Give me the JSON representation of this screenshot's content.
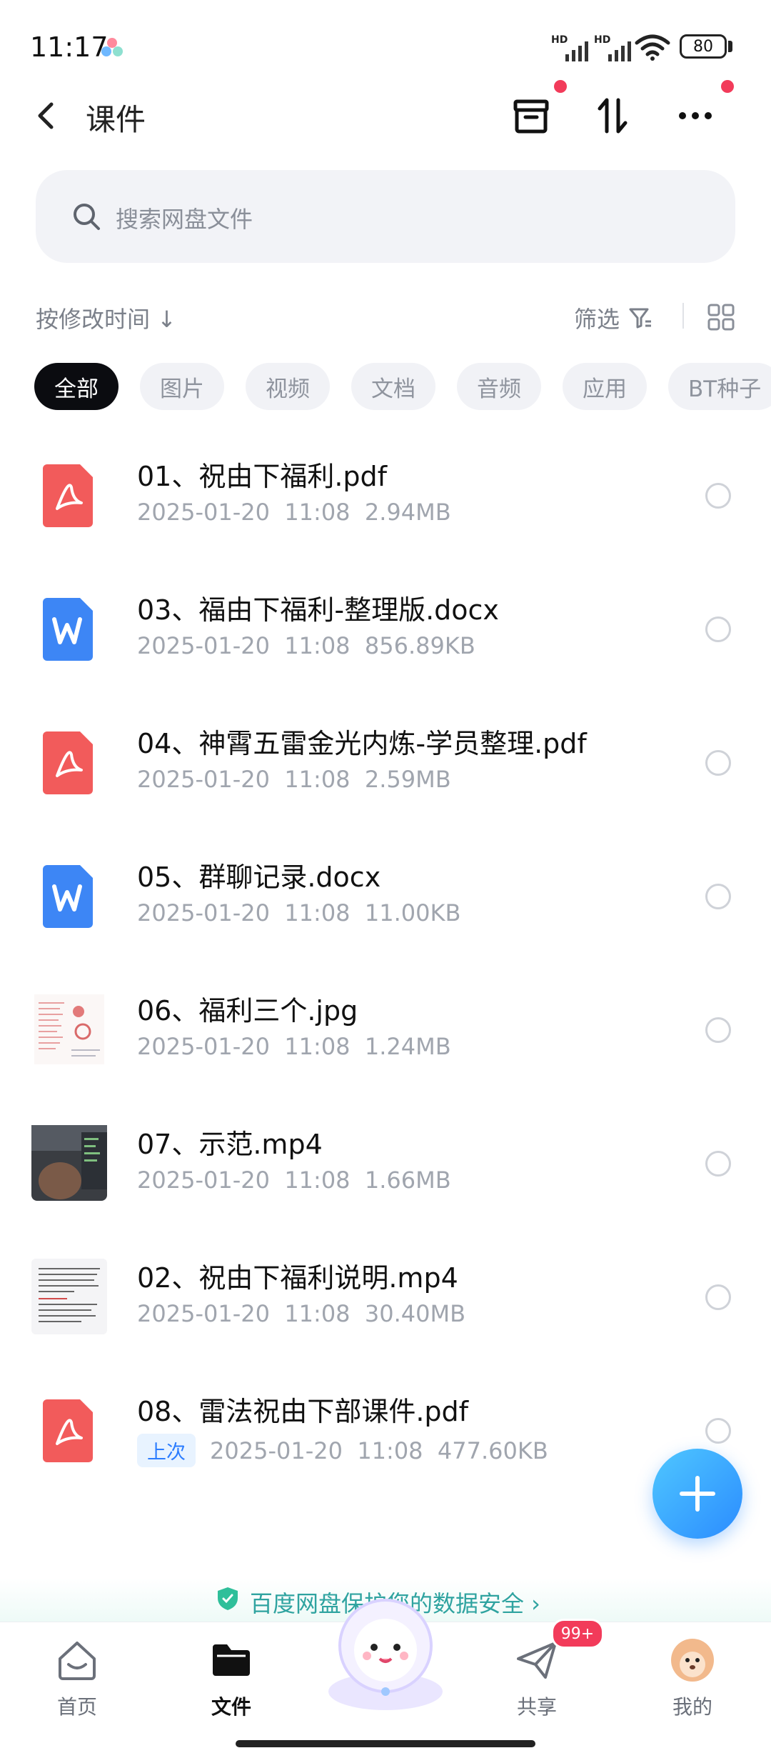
{
  "status_bar": {
    "time": "11:17",
    "sim1": "HD",
    "sim2": "HD",
    "battery": "80"
  },
  "header": {
    "title": "课件"
  },
  "search": {
    "placeholder": "搜索网盘文件"
  },
  "toolbar": {
    "sort_label": "按修改时间 ↓",
    "filter_label": "筛选"
  },
  "chips": [
    "全部",
    "图片",
    "视频",
    "文档",
    "音频",
    "应用",
    "BT种子"
  ],
  "files": [
    {
      "name": "01、祝由下福利.pdf",
      "date": "2025-01-20",
      "time": "11:08",
      "size": "2.94MB",
      "type": "pdf"
    },
    {
      "name": "03、福由下福利-整理版.docx",
      "date": "2025-01-20",
      "time": "11:08",
      "size": "856.89KB",
      "type": "word"
    },
    {
      "name": "04、神霄五雷金光内炼-学员整理.pdf",
      "date": "2025-01-20",
      "time": "11:08",
      "size": "2.59MB",
      "type": "pdf"
    },
    {
      "name": "05、群聊记录.docx",
      "date": "2025-01-20",
      "time": "11:08",
      "size": "11.00KB",
      "type": "word"
    },
    {
      "name": "06、福利三个.jpg",
      "date": "2025-01-20",
      "time": "11:08",
      "size": "1.24MB",
      "type": "image"
    },
    {
      "name": "07、示范.mp4",
      "date": "2025-01-20",
      "time": "11:08",
      "size": "1.66MB",
      "type": "video"
    },
    {
      "name": "02、祝由下福利说明.mp4",
      "date": "2025-01-20",
      "time": "11:08",
      "size": "30.40MB",
      "type": "doc-thumb"
    },
    {
      "name": "08、雷法祝由下部课件.pdf",
      "date": "2025-01-20",
      "time": "11:08",
      "size": "477.60KB",
      "type": "pdf",
      "badge": "上次"
    }
  ],
  "banner": {
    "text": "百度网盘保护您的数据安全 ›"
  },
  "nav": {
    "items": [
      {
        "label": "首页"
      },
      {
        "label": "文件"
      },
      {
        "label": ""
      },
      {
        "label": "共享"
      },
      {
        "label": "我的"
      }
    ],
    "share_badge": "99+"
  },
  "colors": {
    "accent": "#2b8cff",
    "pdf": "#f25b5b",
    "word": "#3d86f5",
    "red_dot": "#f23b5a"
  }
}
